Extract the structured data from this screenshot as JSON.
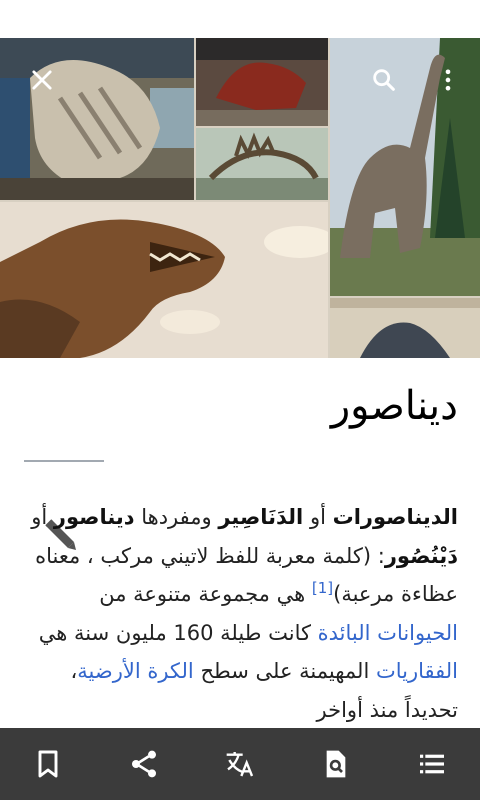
{
  "article": {
    "title": "ديناصور",
    "p1_b1": "الديناصورات",
    "p1_t1": " أو ",
    "p1_b2": "الدَنَاصِير",
    "p1_t2": " ومفردها ",
    "p1_b3": "ديناصور",
    "p1_t3": " أو ",
    "p1_b4": "دَيْنُصُور",
    "p1_t4": ": (كلمة معربة للفظ لاتيني مركب ، معناه عظاءة مرعبة)",
    "ref1": "[1]",
    "p1_t5": " هي مجموعة متنوعة من ",
    "link1": "الحيوانات البائدة",
    "p1_t6": " كانت طيلة 160 مليون سنة هي ",
    "link2": "الفقاريات",
    "p1_t7": " المهيمنة على سطح ",
    "link3": "الكرة الأرضية",
    "p1_t8": "، تحديداً منذ أواخر"
  },
  "header": {
    "close_icon": "close-icon",
    "search_icon": "search-icon",
    "overflow_icon": "overflow-menu-icon"
  },
  "toolbar": {
    "items": [
      "bookmark-icon",
      "share-icon",
      "translate-icon",
      "find-in-page-icon",
      "table-of-contents-icon"
    ]
  },
  "colors": {
    "link": "#3366cc",
    "toolbar_bg": "#3b3b3b",
    "rule": "#a2a9b1"
  }
}
